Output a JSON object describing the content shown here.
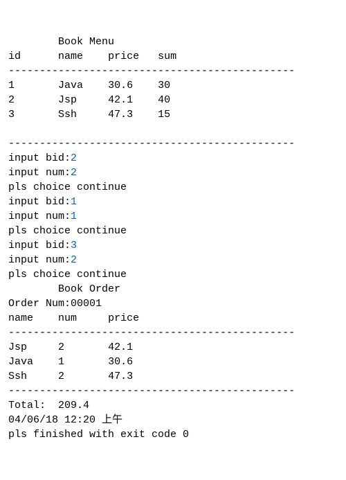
{
  "menu": {
    "title": "Book Menu",
    "headers": {
      "id": "id",
      "name": "name",
      "price": "price",
      "sum": "sum"
    },
    "rows": [
      {
        "id": "1",
        "name": "Java",
        "price": "30.6",
        "sum": "30"
      },
      {
        "id": "2",
        "name": "Jsp",
        "price": "42.1",
        "sum": "40"
      },
      {
        "id": "3",
        "name": "Ssh",
        "price": "47.3",
        "sum": "15"
      }
    ]
  },
  "separator": "----------------------------------------------",
  "inputs": {
    "bid_label": "input bid:",
    "num_label": "input num:",
    "continue_msg": "pls choice continue",
    "entries": [
      {
        "bid": "2",
        "num": "2"
      },
      {
        "bid": "1",
        "num": "1"
      },
      {
        "bid": "3",
        "num": "2"
      }
    ]
  },
  "order": {
    "title": "Book Order",
    "order_num_label": "Order Num:",
    "order_num": "00001",
    "headers": {
      "name": "name",
      "num": "num",
      "price": "price"
    },
    "rows": [
      {
        "name": "Jsp",
        "num": "2",
        "price": "42.1"
      },
      {
        "name": "Java",
        "num": "1",
        "price": "30.6"
      },
      {
        "name": "Ssh",
        "num": "2",
        "price": "47.3"
      }
    ],
    "total_label": "Total:",
    "total_value": "209.4",
    "timestamp": "04/06/18 12:20 上午",
    "exit_msg": "pls finished with exit code 0"
  }
}
